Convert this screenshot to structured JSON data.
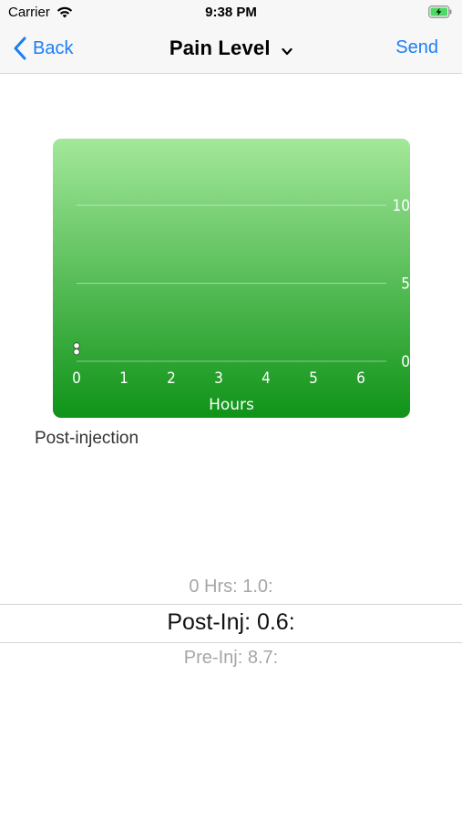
{
  "status_bar": {
    "carrier": "Carrier",
    "time": "9:38 PM",
    "wifi_icon": "wifi-icon",
    "battery_icon": "battery-charging-icon"
  },
  "nav": {
    "back_label": "Back",
    "title": "Pain Level",
    "send_label": "Send",
    "accent_color": "#1a7ff5"
  },
  "chart_data": {
    "type": "scatter",
    "title": "",
    "xlabel": "Hours",
    "ylabel": "",
    "x_ticks": [
      "0",
      "1",
      "2",
      "3",
      "4",
      "5",
      "6"
    ],
    "y_ticks": [
      "10",
      "5",
      "0"
    ],
    "xlim": [
      0,
      6
    ],
    "ylim": [
      0,
      10
    ],
    "grid": true,
    "y_axis_side": "right",
    "background_colors": [
      "#a3e89a",
      "#0f9318"
    ],
    "series": [
      {
        "points": [
          {
            "x": 0,
            "y": 1.0,
            "color": "#ffffff"
          },
          {
            "x": 0,
            "y": 0.6,
            "color": "#ffffff"
          }
        ]
      }
    ]
  },
  "section_label": "Post-injection",
  "picker": {
    "above": "0 Hrs: 1.0:",
    "selected": "Post-Inj: 0.6:",
    "below": "Pre-Inj: 8.7:"
  }
}
